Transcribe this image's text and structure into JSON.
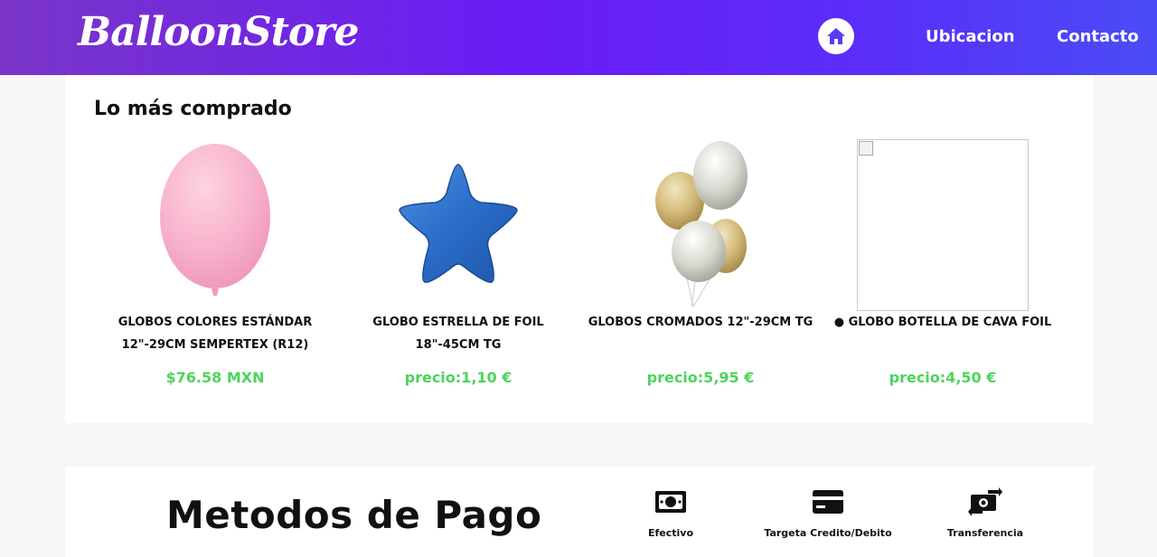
{
  "header": {
    "logo": "BalloonStore",
    "nav": {
      "home_icon": "home-icon",
      "ubicacion": "Ubicacion",
      "contacto": "Contacto"
    }
  },
  "products_section": {
    "title": "Lo más comprado",
    "items": [
      {
        "name": "GLOBOS COLORES ESTÁNDAR 12\"-29CM SEMPERTEX (R12)",
        "price": "$76.58 MXN",
        "image": "pink-balloon"
      },
      {
        "name": "GLOBO ESTRELLA DE FOIL 18\"-45CM TG",
        "price": "precio:1,10 €",
        "image": "blue-star-foil"
      },
      {
        "name": "GLOBOS CROMADOS 12\"-29CM TG",
        "price": "precio:5,95 €",
        "image": "chrome-balloons"
      },
      {
        "name": "● GLOBO BOTELLA DE CAVA FOIL",
        "price": "precio:4,50 €",
        "image": "broken-image"
      }
    ]
  },
  "payment_section": {
    "title": "Metodos de Pago",
    "methods": [
      {
        "label": "Efectivo",
        "icon": "cash-icon"
      },
      {
        "label": "Targeta Credito/Debito",
        "icon": "credit-card-icon"
      },
      {
        "label": "Transferencia",
        "icon": "transfer-icon"
      }
    ]
  },
  "colors": {
    "header_gradient_start": "#7a35c8",
    "header_gradient_end": "#4a4cf6",
    "price": "#4cd45c"
  }
}
